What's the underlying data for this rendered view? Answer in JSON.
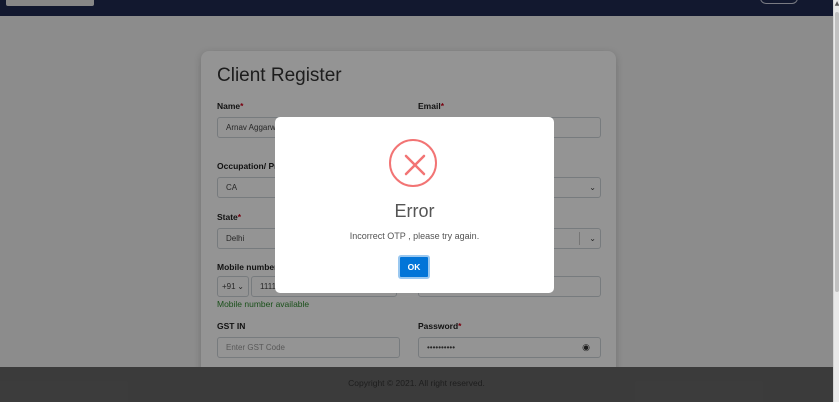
{
  "form": {
    "title": "Client Register",
    "name": {
      "label": "Name",
      "req": "*",
      "value": "Arnav Aggarwal"
    },
    "email": {
      "label": "Email",
      "req": "*",
      "value": ""
    },
    "occupation": {
      "label": "Occupation/ Profession",
      "value": "CA"
    },
    "state": {
      "label": "State",
      "req": "*",
      "value": "Delhi"
    },
    "mobile": {
      "label": "Mobile number",
      "code": "+91",
      "value": "1111",
      "status": "Mobile number available"
    },
    "gst": {
      "label": "GST IN",
      "placeholder": "Enter GST Code"
    },
    "password": {
      "label": "Password",
      "req": "*",
      "value": "••••••••••"
    }
  },
  "modal": {
    "title": "Error",
    "message": "Incorrect OTP , please try again.",
    "ok_label": "OK",
    "icon": "error-x-icon",
    "icon_color": "#f27474",
    "button_color": "#0275d8"
  },
  "footer": {
    "text": "Copyright © 2021. All right reserved."
  },
  "colors": {
    "navbar": "#1f2a52",
    "footer": "#676767",
    "available": "#2e8b2e",
    "required": "#d0021b"
  }
}
